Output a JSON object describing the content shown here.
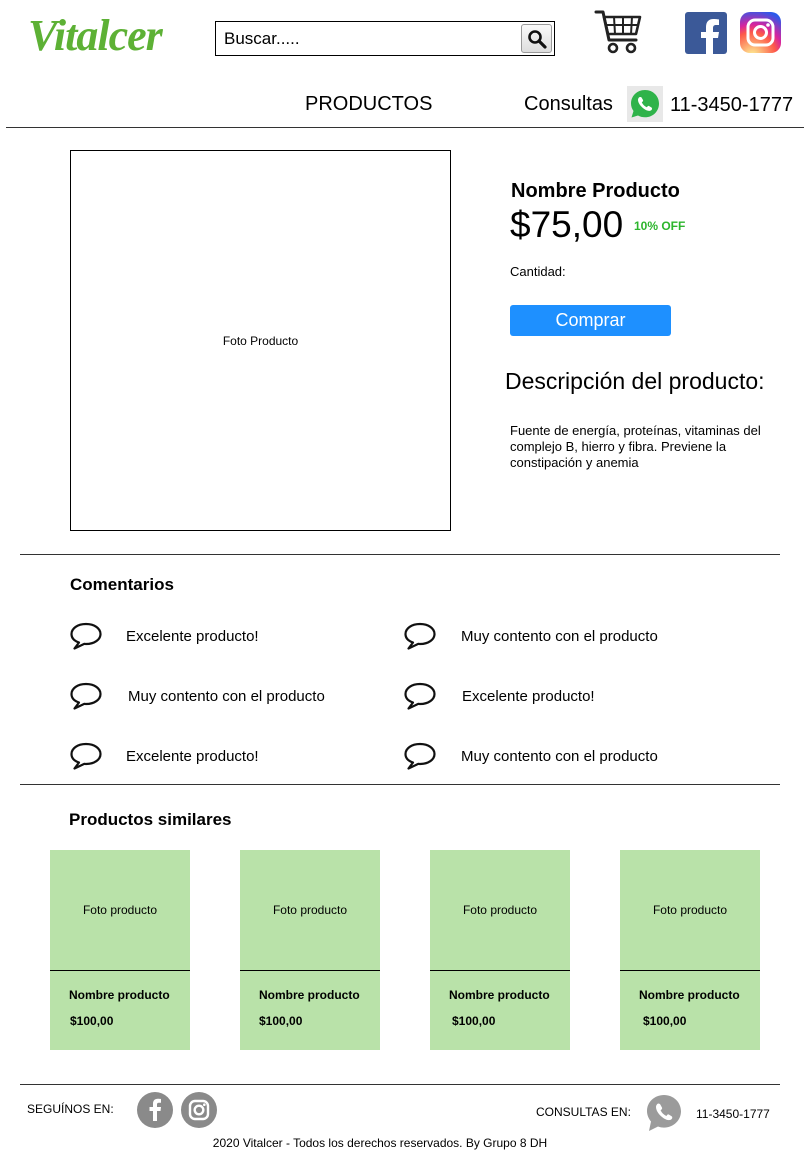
{
  "header": {
    "logo_text": "Vitalcer",
    "search_placeholder": "Buscar.....",
    "nav_productos": "PRODUCTOS",
    "nav_consultas": "Consultas",
    "phone": "11-3450-1777"
  },
  "product": {
    "photo_label": "Foto Producto",
    "name": "Nombre Producto",
    "price": "$75,00",
    "discount": "10% OFF",
    "quantity_label": "Cantidad:",
    "buy_label": "Comprar",
    "description_title": "Descripción del producto:",
    "description": "Fuente de energía, proteínas, vitaminas del complejo B, hierro y fibra. Previene la constipación y anemia"
  },
  "comments": {
    "title": "Comentarios",
    "items": [
      "Excelente producto!",
      "Muy contento con el producto",
      "Muy contento con el producto",
      "Excelente producto!",
      "Excelente producto!",
      "Muy contento con el producto"
    ]
  },
  "similar": {
    "title": "Productos similares",
    "items": [
      {
        "photo": "Foto producto",
        "name": "Nombre producto",
        "price": "$100,00"
      },
      {
        "photo": "Foto producto",
        "name": "Nombre producto",
        "price": "$100,00"
      },
      {
        "photo": "Foto producto",
        "name": "Nombre producto",
        "price": "$100,00"
      },
      {
        "photo": "Foto producto",
        "name": "Nombre producto",
        "price": "$100,00"
      }
    ]
  },
  "footer": {
    "follow_label": "SEGUÍNOS EN:",
    "contact_label": "CONSULTAS EN:",
    "phone": "11-3450-1777",
    "copyright": "2020 Vitalcer - Todos los derechos reservados. By Grupo 8 DH"
  },
  "colors": {
    "brand_green": "#5db135",
    "card_green": "#b9e2a9",
    "buy_blue": "#1e90ff",
    "discount_green": "#2db52d"
  },
  "icons": [
    "search-icon",
    "cart-icon",
    "facebook-icon",
    "instagram-icon",
    "whatsapp-icon",
    "comment-icon",
    "phone-icon"
  ]
}
